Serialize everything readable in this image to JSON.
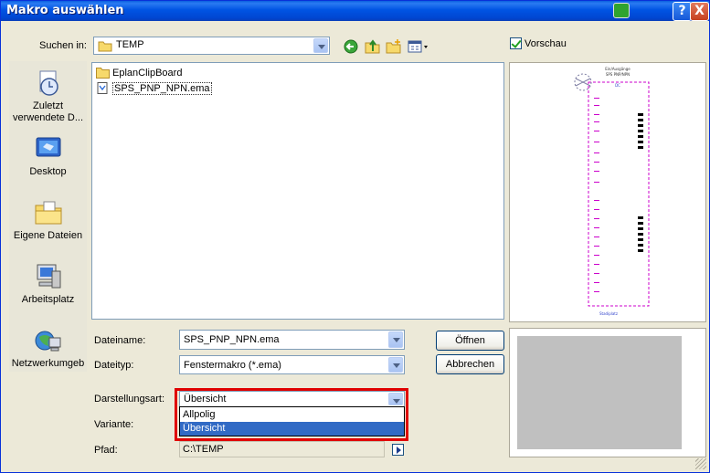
{
  "window": {
    "title": "Makro auswählen",
    "help_button": "?",
    "close_button": "X"
  },
  "toolbar": {
    "search_label": "Suchen in:",
    "location": "TEMP",
    "preview_label": "Vorschau",
    "preview_checked": true
  },
  "places": [
    {
      "label": "Zuletzt verwendete D...",
      "icon": "recent-documents-icon"
    },
    {
      "label": "Desktop",
      "icon": "desktop-icon"
    },
    {
      "label": "Eigene Dateien",
      "icon": "my-documents-icon"
    },
    {
      "label": "Arbeitsplatz",
      "icon": "my-computer-icon"
    },
    {
      "label": "Netzwerkumgeb",
      "icon": "network-icon"
    }
  ],
  "files": [
    {
      "name": "EplanClipBoard",
      "type": "folder"
    },
    {
      "name": "SPS_PNP_NPN.ema",
      "type": "macro-file"
    }
  ],
  "form": {
    "filename_label": "Dateiname:",
    "filename_value": "SPS_PNP_NPN.ema",
    "filetype_label": "Dateityp:",
    "filetype_value": "Fenstermakro (*.ema)",
    "display_label": "Darstellungsart:",
    "display_value": "Übersicht",
    "variant_label": "Variante:",
    "path_label": "Pfad:",
    "path_value": "C:\\TEMP"
  },
  "display_options": [
    {
      "label": "Allpolig",
      "selected": false
    },
    {
      "label": "Übersicht",
      "selected": true
    }
  ],
  "buttons": {
    "open": "Öffnen",
    "cancel": "Abbrechen"
  },
  "preview_text": {
    "bottom_caption": "Stadiplatz"
  },
  "colors": {
    "title_bar": "#0054e3",
    "highlight": "#316ac5",
    "callout": "#e00000",
    "preview_lines": "#cc00cc"
  }
}
